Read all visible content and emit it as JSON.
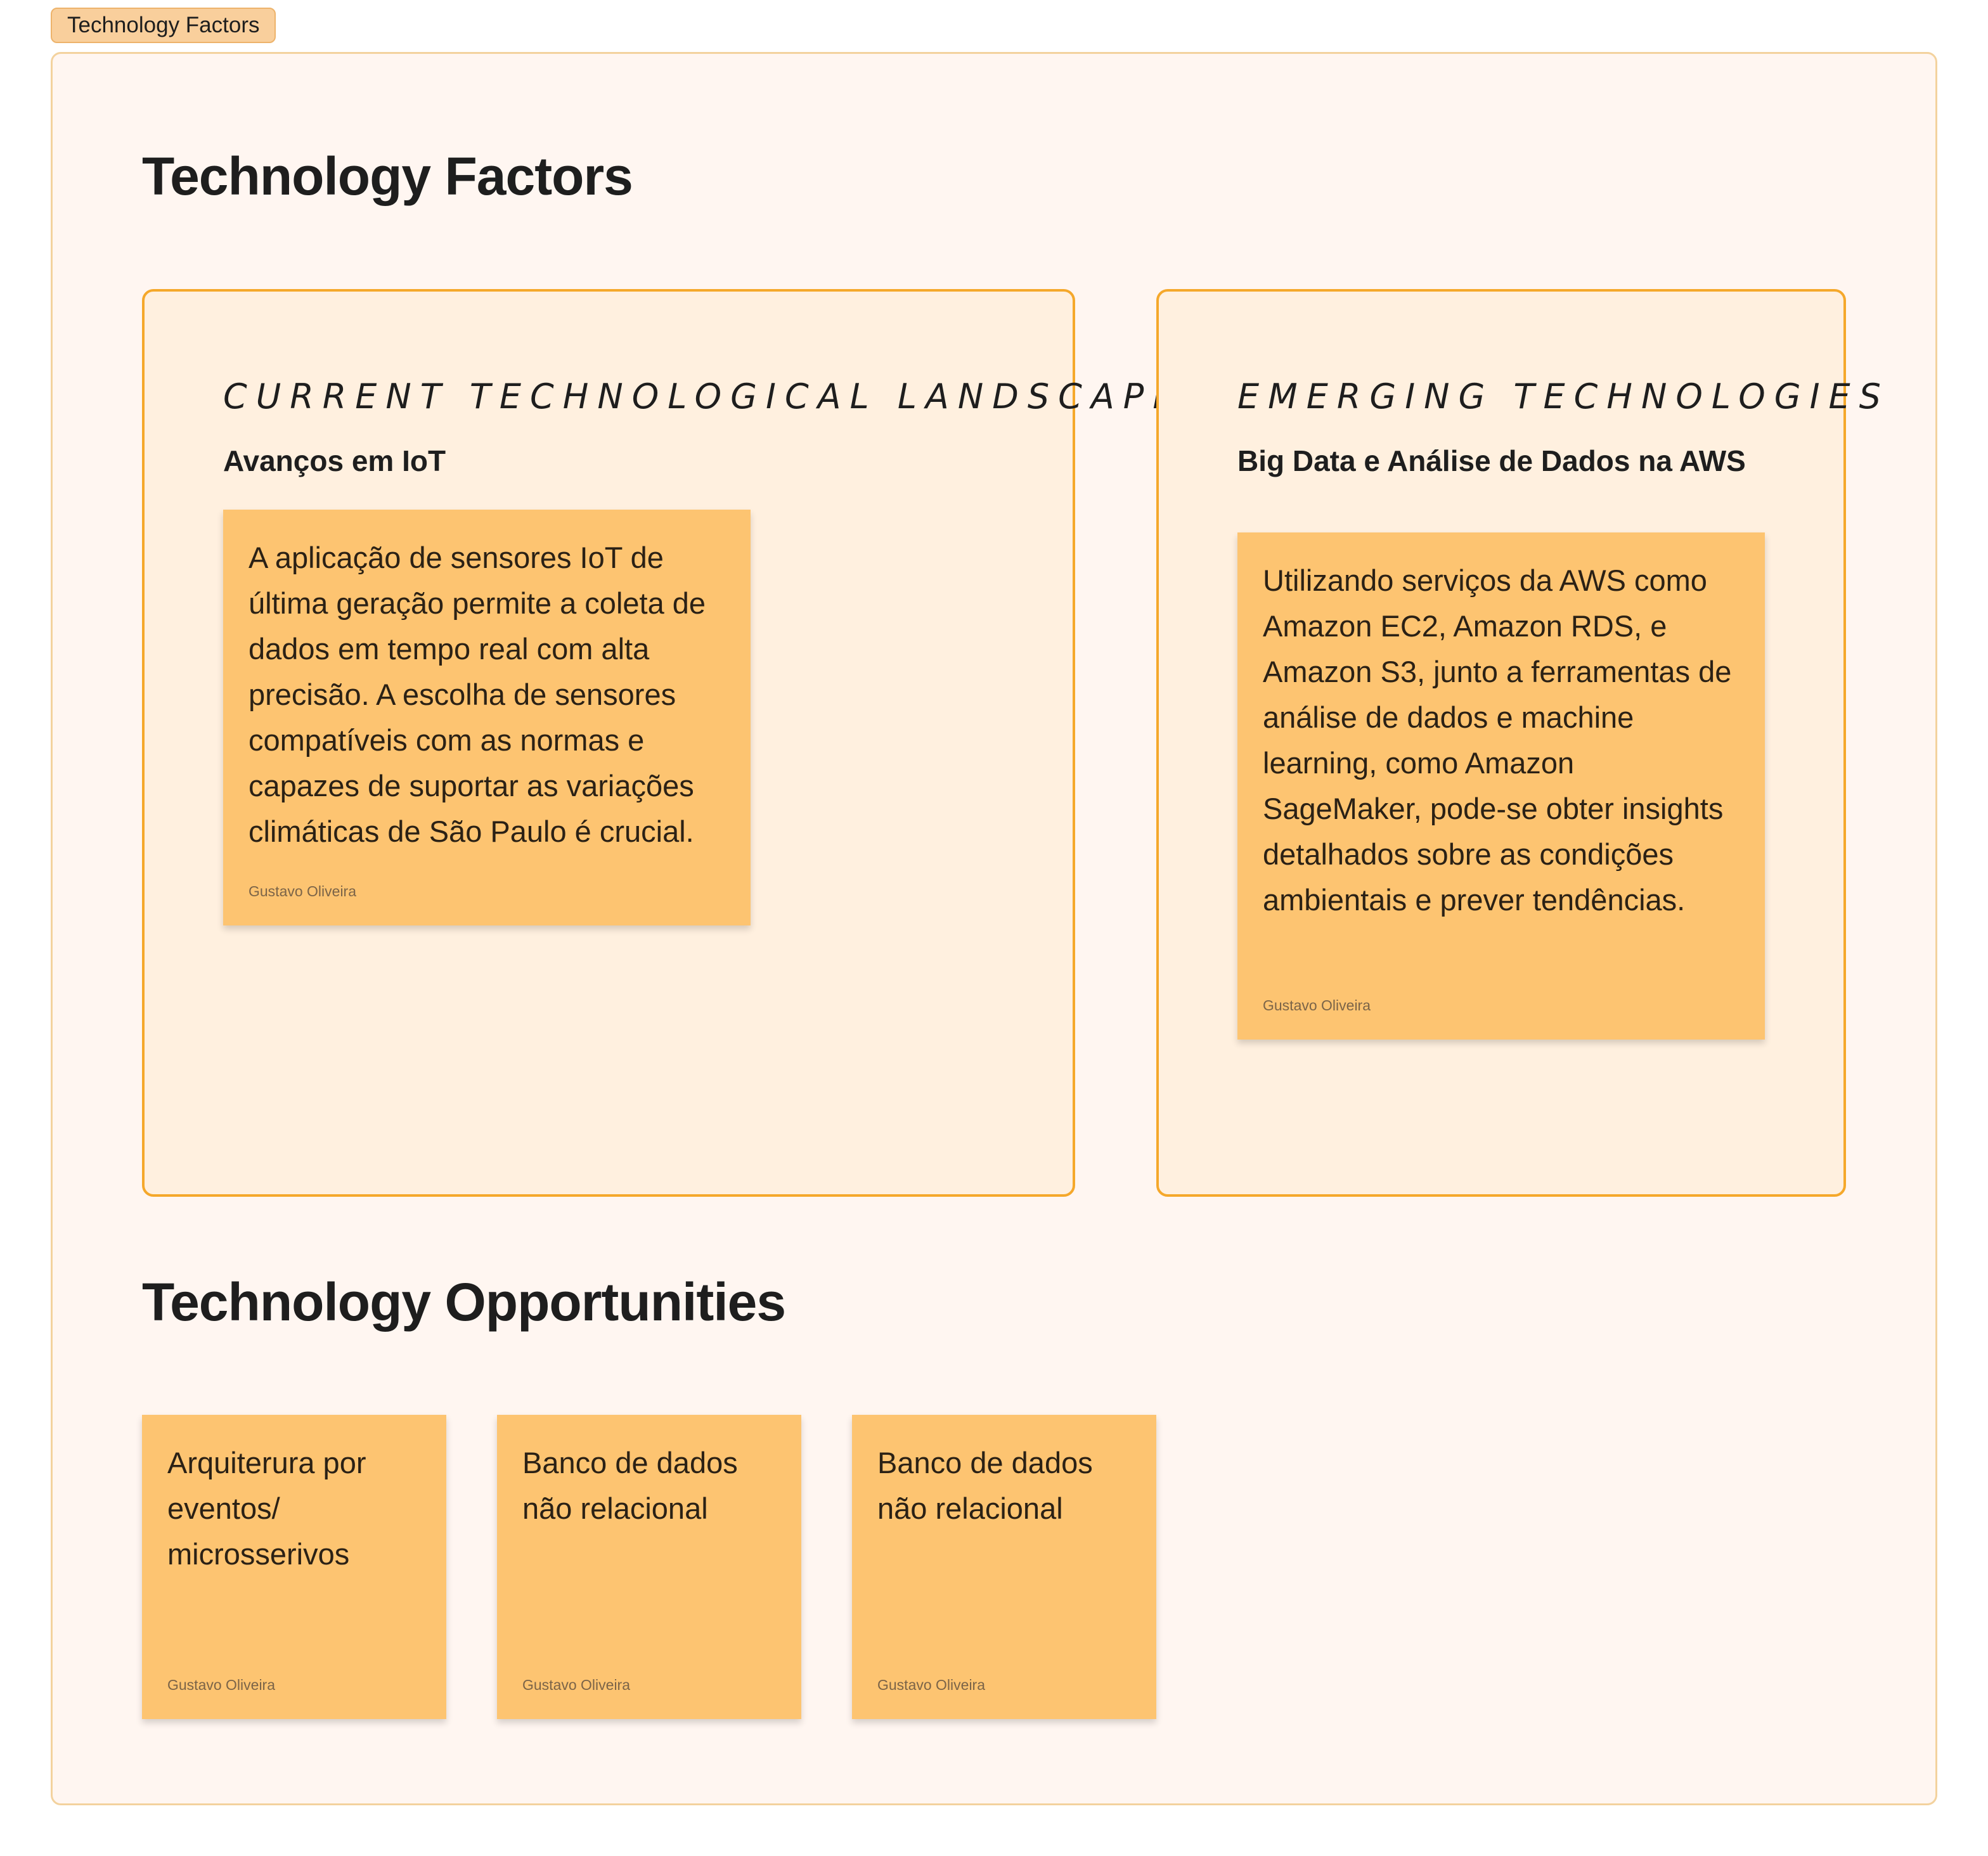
{
  "frame": {
    "tab_label": "Technology Factors"
  },
  "sections": {
    "factors_title": "Technology Factors",
    "opportunities_title": "Technology Opportunities"
  },
  "cards": {
    "current": {
      "heading": "Current Technological Landscape",
      "subheading": "Avanços em IoT",
      "note": {
        "text": "A aplicação de sensores IoT de última geração permite a coleta de dados em tempo real com alta precisão. A escolha de sensores compatíveis com as normas e capazes de suportar as variações climáticas de São Paulo é crucial.",
        "author": "Gustavo Oliveira"
      }
    },
    "emerging": {
      "heading": "Emerging Technologies",
      "subheading": "Big Data e Análise de Dados na AWS",
      "note": {
        "text": "Utilizando serviços da AWS como Amazon EC2, Amazon RDS, e Amazon S3, junto a ferramentas de análise de dados e machine learning, como Amazon SageMaker, pode-se obter insights detalhados sobre as condições ambientais e prever tendências.",
        "author": "Gustavo Oliveira"
      }
    }
  },
  "opportunities": [
    {
      "text": "Arquiterura por eventos/ microsserivos",
      "author": "Gustavo Oliveira"
    },
    {
      "text": "Banco de dados não relacional",
      "author": "Gustavo Oliveira"
    },
    {
      "text": "Banco de dados não relacional",
      "author": "Gustavo Oliveira"
    }
  ],
  "colors": {
    "frame_bg": "#fff6f1",
    "frame_border": "#f3d29e",
    "card_bg": "#fff0df",
    "card_border": "#f5a82b",
    "sticky": "#fdc471",
    "tab_bg": "#f9cf9c"
  }
}
